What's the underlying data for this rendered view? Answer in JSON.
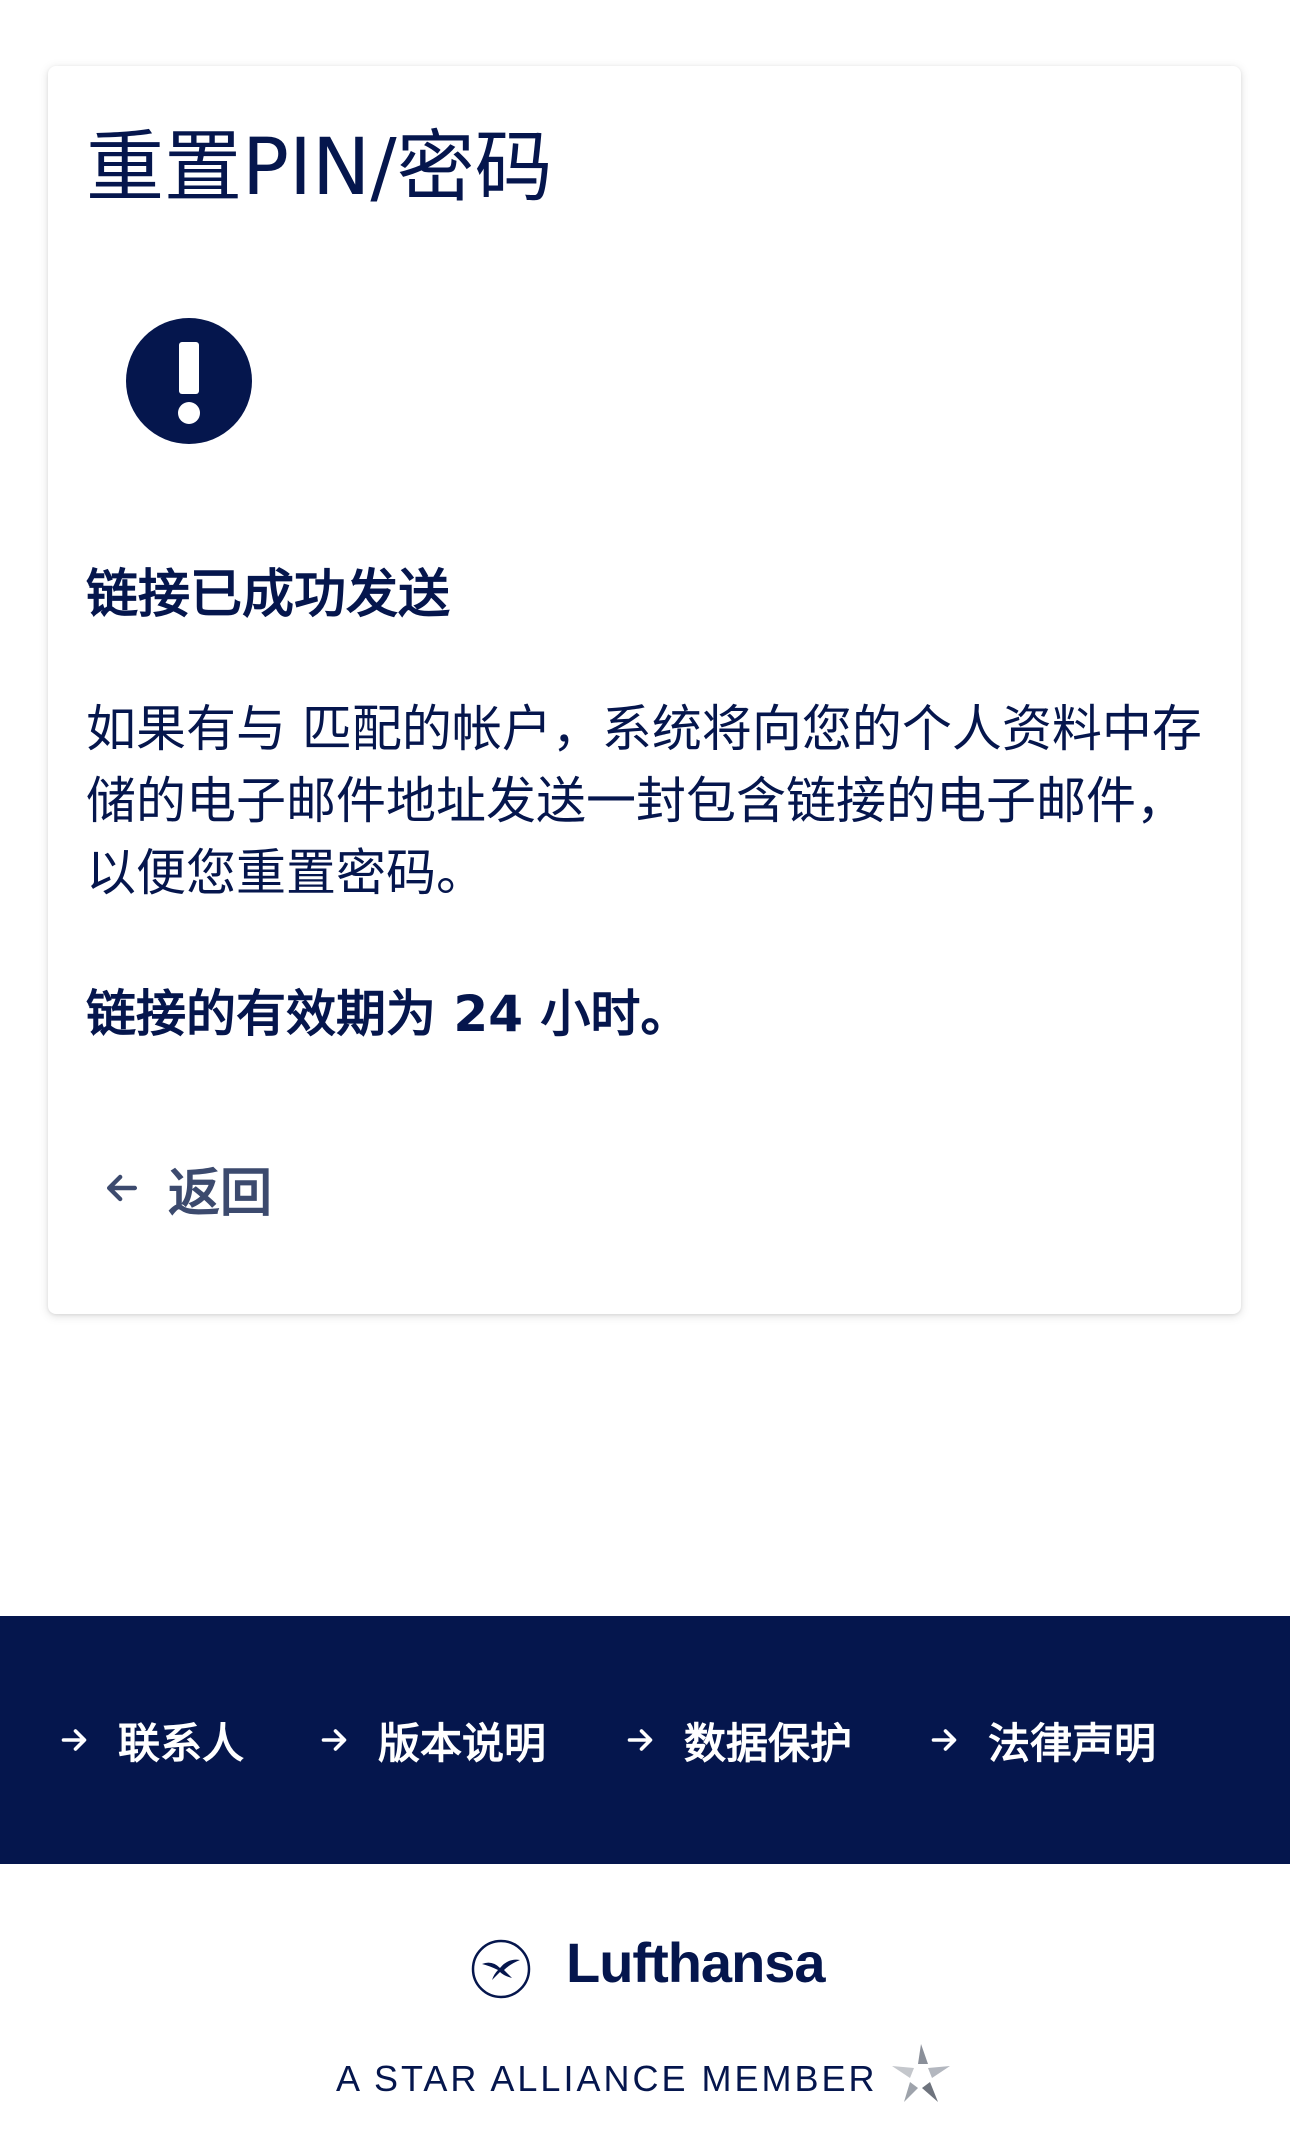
{
  "card": {
    "title": "重置PIN/密码",
    "alert_icon": "exclamation-icon",
    "subheading": "链接已成功发送",
    "body": "如果有与 匹配的帐户，系统将向您的个人资料中存储的电子邮件地址发送一封包含链接的电子邮件，以便您重置密码。",
    "validity": "链接的有效期为 24 小时。",
    "back_label": "返回",
    "back_icon": "arrow-left-icon"
  },
  "footer": {
    "links": [
      {
        "label": "联系人",
        "icon": "arrow-right-icon"
      },
      {
        "label": "版本说明",
        "icon": "arrow-right-icon"
      },
      {
        "label": "数据保护",
        "icon": "arrow-right-icon"
      },
      {
        "label": "法律声明",
        "icon": "arrow-right-icon"
      }
    ]
  },
  "brand": {
    "name": "Lufthansa",
    "logo_icon": "lufthansa-crane-logo",
    "alliance_text": "A STAR ALLIANCE MEMBER",
    "alliance_icon": "star-alliance-logo"
  },
  "colors": {
    "primary": "#05164d",
    "secondary_text": "#3c4a6e",
    "background": "#ffffff",
    "footer_text": "#ffffff"
  }
}
